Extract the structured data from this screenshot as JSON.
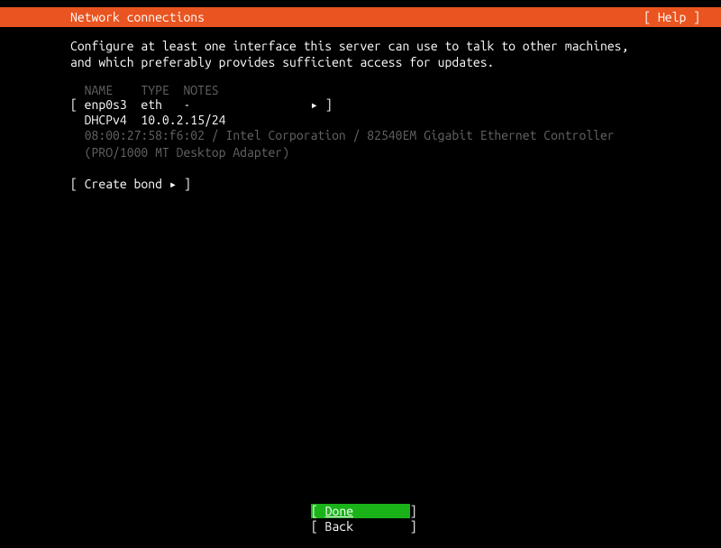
{
  "header": {
    "title": "Network connections",
    "help": "[ Help ]"
  },
  "description": "Configure at least one interface this server can use to talk to other machines, and which preferably provides sufficient access for updates.",
  "table": {
    "headers": "  NAME    TYPE  NOTES",
    "interface_row": "[ enp0s3  eth   -                 ▸ ]",
    "dhcp_row": "  DHCPv4  10.0.2.15/24",
    "mac_info": "  08:00:27:58:f6:02 / Intel Corporation / 82540EM Gigabit Ethernet Controller\n  (PRO/1000 MT Desktop Adapter)"
  },
  "create_bond": "[ Create bond ▸ ]",
  "footer": {
    "done": "[ Done        ]",
    "done_label": "Done",
    "back": "[ Back        ]"
  }
}
